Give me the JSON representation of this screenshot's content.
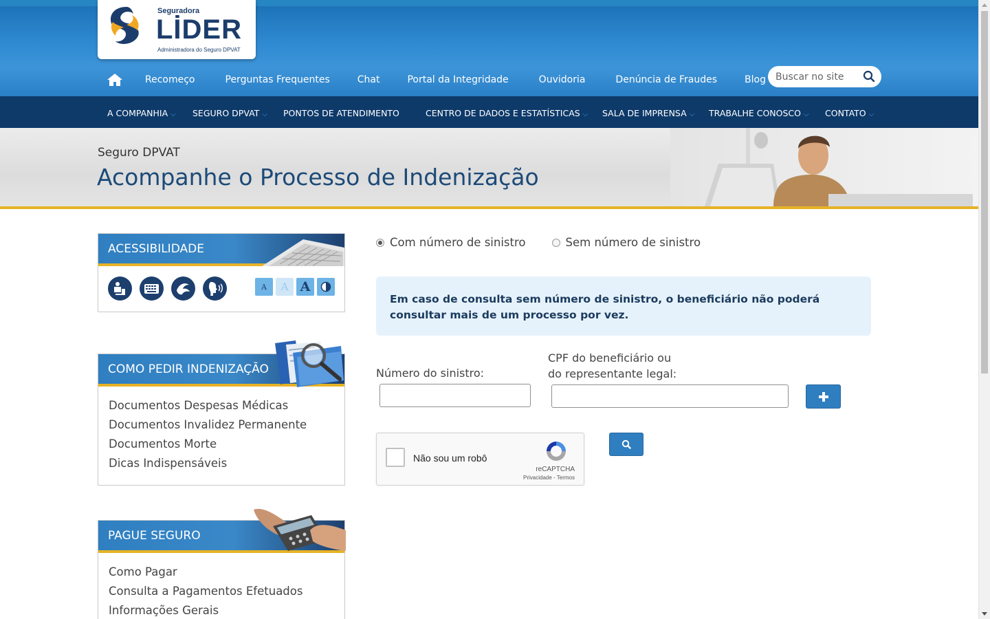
{
  "header": {
    "logo": {
      "small": "Seguradora",
      "big": "LİDER",
      "sub": "Administradora do Seguro DPVAT"
    },
    "top_nav": [
      "Recomeço",
      "Perguntas Frequentes",
      "Chat",
      "Portal da Integridade",
      "Ouvidoria",
      "Denúncia de Fraudes",
      "Blog"
    ],
    "search": {
      "placeholder": "Buscar no site"
    }
  },
  "main_menu": [
    {
      "label": "A COMPANHIA",
      "dropdown": true
    },
    {
      "label": "SEGURO DPVAT",
      "dropdown": true
    },
    {
      "label": "PONTOS DE ATENDIMENTO",
      "dropdown": false
    },
    {
      "label": "CENTRO DE DADOS E ESTATÍSTICAS",
      "dropdown": true
    },
    {
      "label": "SALA DE IMPRENSA",
      "dropdown": true
    },
    {
      "label": "TRABALHE CONOSCO",
      "dropdown": true
    },
    {
      "label": "CONTATO",
      "dropdown": true
    }
  ],
  "page_header": {
    "kicker": "Seguro DPVAT",
    "title": "Acompanhe o Processo de Indenização"
  },
  "sidebar": {
    "accessibility": {
      "title": "ACESSIBILIDADE",
      "font_buttons": [
        "A",
        "A",
        "A"
      ]
    },
    "how_to": {
      "title": "COMO PEDIR INDENIZAÇÃO",
      "links": [
        "Documentos Despesas Médicas",
        "Documentos Invalidez Permanente",
        "Documentos Morte",
        "Dicas Indispensáveis"
      ]
    },
    "pay": {
      "title": "PAGUE SEGURO",
      "links": [
        "Como Pagar",
        "Consulta a Pagamentos Efetuados",
        "Informações Gerais"
      ]
    }
  },
  "form": {
    "radio_with": "Com número de sinistro",
    "radio_without": "Sem número de sinistro",
    "selected": "with",
    "notice": "Em caso de consulta sem número de sinistro, o beneficiário não poderá consultar mais de um processo por vez.",
    "label_claim": "Número do sinistro:",
    "label_cpf_1": "CPF do beneficiário ou",
    "label_cpf_2": "do representante legal:",
    "claim_value": "",
    "cpf_value": ""
  },
  "captcha": {
    "label": "Não sou um robô",
    "brand": "reCAPTCHA",
    "privacy": "Privacidade",
    "sep": " - ",
    "terms": "Termos"
  },
  "colors": {
    "nav_dark": "#0e3a6a",
    "accent_gold": "#e6b326",
    "brand_blue": "#2f7ec0",
    "title_blue": "#1b4a78"
  }
}
